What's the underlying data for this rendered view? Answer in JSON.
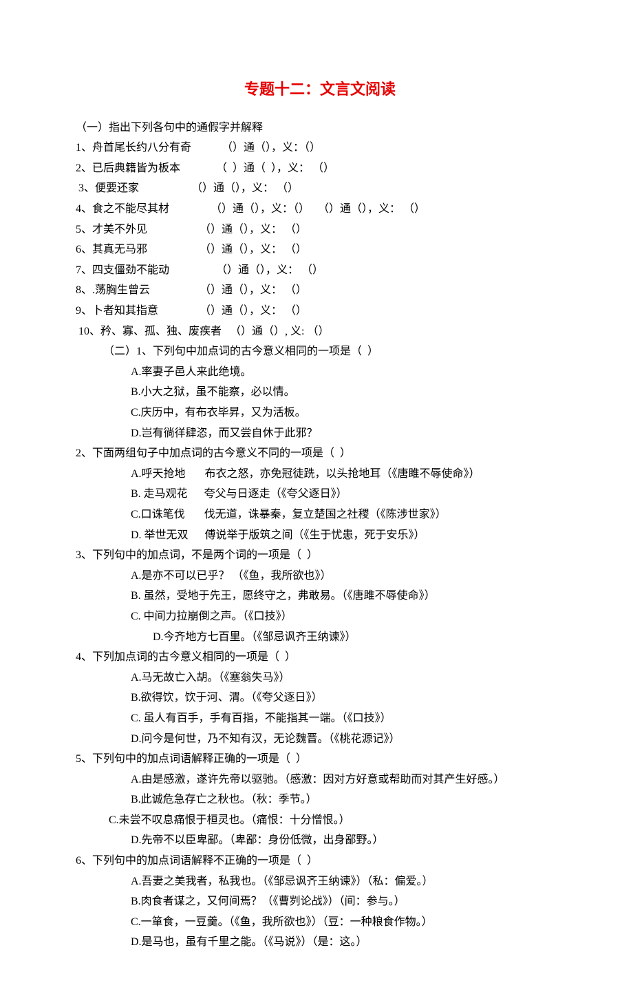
{
  "title": "专题十二：文言文阅读",
  "section1": {
    "heading": "（一）指出下列各句中的通假字并解释",
    "items": [
      "1、舟首尾长约八分有奇           （）通（），义：（）",
      "2、已后典籍皆为板本             （  ）通（  ），义： （）",
      " 3、便要还家                   （）通（），义： （）",
      "4、食之不能尽其材               （）通（），义：（）   （）通（），义： （）",
      "5、才美不外见                   （）通（），义： （）",
      "6、其真无马邪                   （）通（），义： （）",
      "7、四支僵劲不能动                 （）通（），义： （）",
      "8、.荡胸生曾云                  （）通（），义： （）",
      "9、卜者知其指意               （）通（），义： （）",
      " 10、矜、寡、孤、独、废疾者   （）通（）, 义: （）"
    ]
  },
  "section2": {
    "q1": {
      "stem": "（二）1、下列句中加点词的古今意义相同的一项是（  ）",
      "opts": [
        "A.率妻子邑人来此绝境。",
        "B.小大之狱，虽不能察，必以情。",
        "C.庆历中，有布衣毕昇，又为活板。",
        "D.岂有徜徉肆恣，而又尝自休于此邪？"
      ]
    },
    "q2": {
      "stem": "2、下面两组句子中加点词的古今意义不同的一项是（  ）",
      "opts": [
        "A.呼天抢地       布衣之怒，亦免冠徒跣，以头抢地耳（《唐雎不辱使命》）",
        "B. 走马观花      夸父与日逐走（《夸父逐日》）",
        "C.口诛笔伐       伐无道，诛暴秦，复立楚国之社稷（《陈涉世家》）",
        "D. 举世无双      傅说举于版筑之间（《生于忧患，死于安乐》）"
      ]
    },
    "q3": {
      "stem": "3、下列句中的加点词，不是两个词的一项是（  ）",
      "opts": [
        "A.是亦不可以已乎？ （《鱼，我所欲也》）",
        "B. 虽然，受地于先王，愿终守之，弗敢易。（《唐雎不辱使命》）",
        "C. 中间力拉崩倒之声。（《口技》）",
        "D.今齐地方七百里。（《邹忌讽齐王纳谏》）"
      ]
    },
    "q4": {
      "stem": "4、下列加点词的古今意义相同的一项是（  ）",
      "opts": [
        "A.马无故亡入胡。（《塞翁失马》）",
        "B.欲得饮，饮于河、渭。（《夸父逐日》）",
        "C. 虽人有百手，手有百指，不能指其一端。（《口技》）",
        "D.问今是何世，乃不知有汉，无论魏晋。（《桃花源记》）"
      ]
    },
    "q5": {
      "stem": "5、下列句中的加点词语解释正确的一项是（  ）",
      "opts": [
        "A.由是感激，遂许先帝以驱驰。（感激：因对方好意或帮助而对其产生好感。）",
        "B.此诚危急存亡之秋也。（秋：季节。）",
        "C.未尝不叹息痛恨于桓灵也。（痛恨：十分憎恨。）",
        "D.先帝不以臣卑鄙。（卑鄙：身份低微，出身鄙野。）"
      ]
    },
    "q6": {
      "stem": "6、下列句中的加点词语解释不正确的一项是（  ）",
      "opts": [
        "A.吾妻之美我者，私我也。（《邹忌讽齐王纳谏》）（私：偏爱。）",
        "B.肉食者谋之，又何间焉？（《曹刿论战》）（间：参与。）",
        "C.一箪食，一豆羹。（《鱼，我所欲也》）（豆：一种粮食作物。）",
        "D.是马也，虽有千里之能。（《马说》）（是：这。）"
      ]
    }
  }
}
